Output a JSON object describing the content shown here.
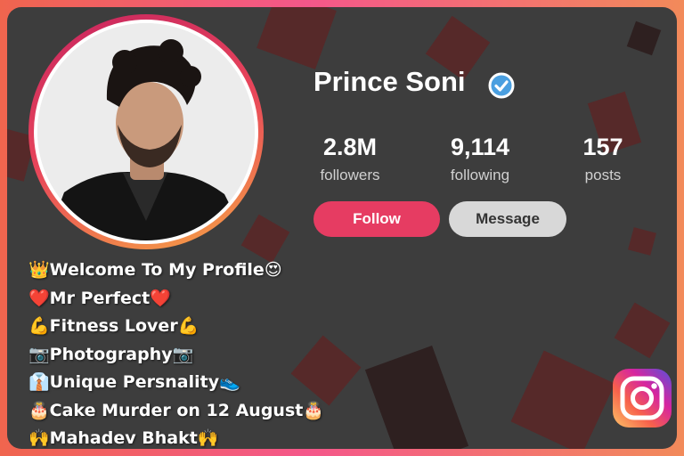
{
  "profile": {
    "name": "Prince Soni",
    "verified": true,
    "stats": [
      {
        "value": "2.8M",
        "label": "followers"
      },
      {
        "value": "9,114",
        "label": "following"
      },
      {
        "value": "157",
        "label": "posts"
      }
    ],
    "buttons": {
      "follow": "Follow",
      "message": "Message"
    }
  },
  "bio": [
    {
      "prefix": "👑",
      "text": "Welcome To My Profile ",
      "suffix": "😍"
    },
    {
      "prefix": "❤️",
      "text": "Mr Perfect",
      "suffix": "❤️"
    },
    {
      "prefix": "💪",
      "text": " Fitness Lover",
      "suffix": "💪"
    },
    {
      "prefix": "📷",
      "text": "Photography",
      "suffix": "📷"
    },
    {
      "prefix": "👔",
      "text": " Unique Persnality ",
      "suffix": "👟"
    },
    {
      "prefix": "🎂",
      "text": "Cake Murder on 12 August ",
      "suffix": "🎂"
    },
    {
      "prefix": "🙌",
      "text": "Mahadev Bhakt",
      "suffix": "🙌"
    }
  ],
  "icons": {
    "verified": "verified-badge-icon",
    "brand": "instagram-icon"
  },
  "colors": {
    "follow": "#e63c62",
    "message": "#d8d8d8",
    "verified": "#4a9fe0",
    "card": "#3d3d3d"
  }
}
